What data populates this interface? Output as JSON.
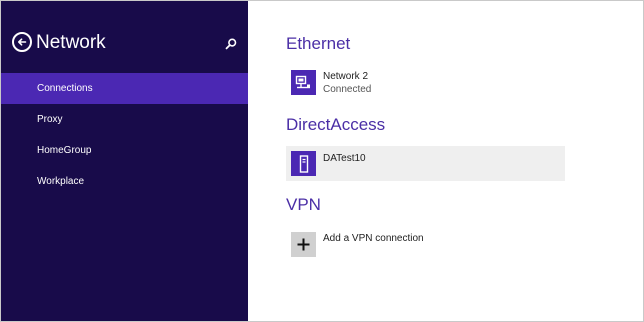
{
  "sidebar": {
    "title": "Network",
    "items": [
      {
        "label": "Connections",
        "active": true
      },
      {
        "label": "Proxy",
        "active": false
      },
      {
        "label": "HomeGroup",
        "active": false
      },
      {
        "label": "Workplace",
        "active": false
      }
    ]
  },
  "sections": {
    "ethernet": {
      "heading": "Ethernet",
      "item": {
        "name": "Network  2",
        "status": "Connected",
        "icon": "network-adapter-icon"
      }
    },
    "directaccess": {
      "heading": "DirectAccess",
      "item": {
        "name": "DATest10",
        "icon": "computer-tower-icon"
      }
    },
    "vpn": {
      "heading": "VPN",
      "add_label": "Add a VPN connection",
      "icon": "plus-icon"
    }
  },
  "colors": {
    "sidebar_bg": "#180b4a",
    "accent": "#4b28b3",
    "heading": "#4b2fa6"
  }
}
